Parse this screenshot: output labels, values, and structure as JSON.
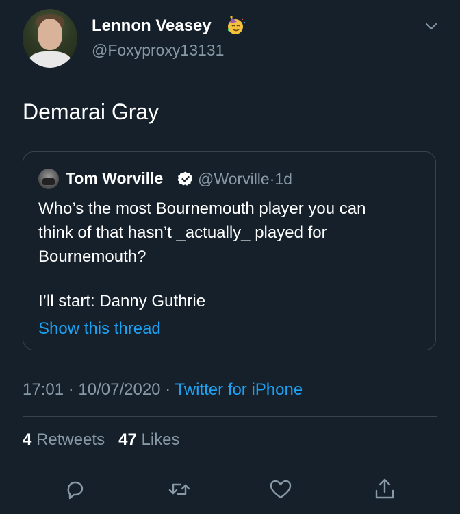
{
  "author": {
    "display_name": "Lennon Veasey",
    "handle": "@Foxyproxy13131",
    "name_emoji_icon": "partying-face-emoji",
    "menu_icon": "chevron-down-icon"
  },
  "tweet": {
    "text": "Demarai Gray"
  },
  "quoted_tweet": {
    "display_name": "Tom Worville",
    "verified_icon": "verified-badge-icon",
    "handle": "@Worville",
    "separator": "·",
    "age": "1d",
    "lines": [
      "Who’s the most Bournemouth player you can",
      "think of that hasn’t _actually_ played for",
      "Bournemouth?",
      "I’ll start: Danny Guthrie"
    ],
    "show_thread_label": "Show this thread"
  },
  "meta": {
    "time": "17:01",
    "separator": "·",
    "date": "10/07/2020",
    "source": "Twitter for iPhone"
  },
  "stats": {
    "retweets_count": "4",
    "retweets_label": "Retweets",
    "likes_count": "47",
    "likes_label": "Likes"
  },
  "actions": {
    "reply_icon": "reply-icon",
    "retweet_icon": "retweet-icon",
    "like_icon": "heart-icon",
    "share_icon": "share-icon"
  },
  "colors": {
    "background": "#15202b",
    "accent": "#1da1f2",
    "secondary_text": "#8899a6",
    "border": "#38444d"
  }
}
